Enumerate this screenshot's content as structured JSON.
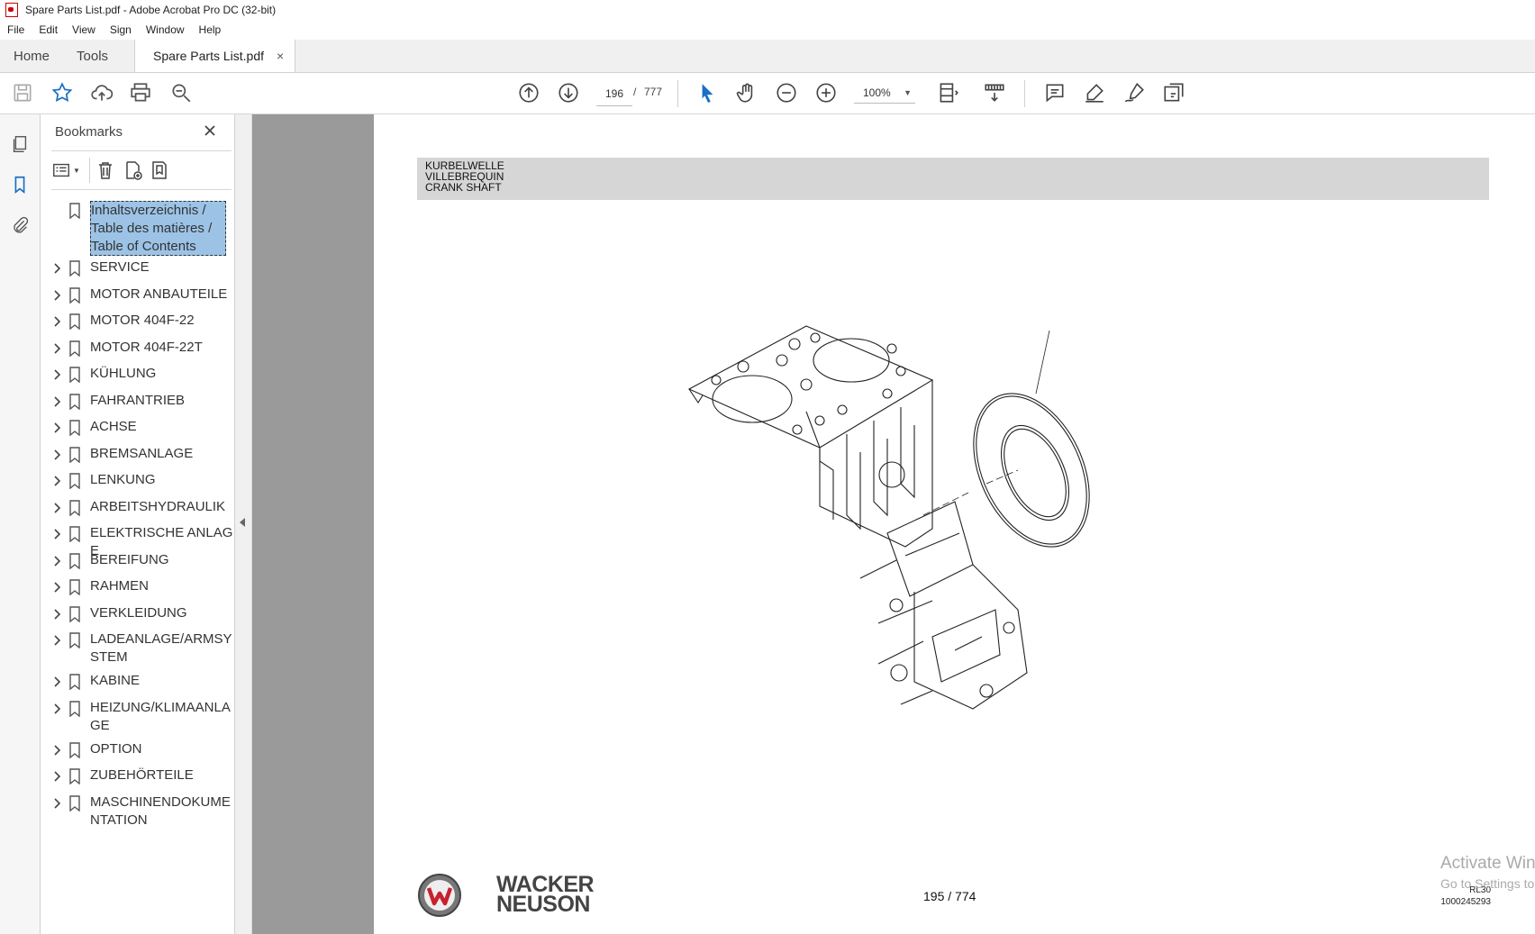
{
  "window": {
    "title": "Spare Parts List.pdf - Adobe Acrobat Pro DC (32-bit)"
  },
  "menu": [
    "File",
    "Edit",
    "View",
    "Sign",
    "Window",
    "Help"
  ],
  "tabs": {
    "home": "Home",
    "tools": "Tools",
    "document": "Spare Parts List.pdf",
    "close": "×"
  },
  "toolbar": {
    "page_current": "196",
    "page_sep": "/",
    "page_total": "777",
    "zoom": "100%"
  },
  "bookmarks": {
    "title": "Bookmarks",
    "items": [
      {
        "label": "Inhaltsverzeichnis / Table des matières / Table of Contents",
        "expandable": false,
        "selected": true
      },
      {
        "label": "SERVICE",
        "expandable": true
      },
      {
        "label": "MOTOR ANBAUTEILE",
        "expandable": true
      },
      {
        "label": "MOTOR 404F-22",
        "expandable": true
      },
      {
        "label": "MOTOR 404F-22T",
        "expandable": true
      },
      {
        "label": "KÜHLUNG",
        "expandable": true
      },
      {
        "label": "FAHRANTRIEB",
        "expandable": true
      },
      {
        "label": "ACHSE",
        "expandable": true
      },
      {
        "label": "BREMSANLAGE",
        "expandable": true
      },
      {
        "label": "LENKUNG",
        "expandable": true
      },
      {
        "label": "ARBEITSHYDRAULIK",
        "expandable": true
      },
      {
        "label": "ELEKTRISCHE ANLAGE",
        "expandable": true
      },
      {
        "label": "BEREIFUNG",
        "expandable": true
      },
      {
        "label": "RAHMEN",
        "expandable": true
      },
      {
        "label": "VERKLEIDUNG",
        "expandable": true
      },
      {
        "label": "LADEANLAGE/ARMSYSTEM",
        "expandable": true
      },
      {
        "label": "KABINE",
        "expandable": true
      },
      {
        "label": "HEIZUNG/KLIMAANLAGE",
        "expandable": true
      },
      {
        "label": "OPTION",
        "expandable": true
      },
      {
        "label": "ZUBEHÖRTEILE",
        "expandable": true
      },
      {
        "label": "MASCHINENDOKUMENTATION",
        "expandable": true
      }
    ]
  },
  "page": {
    "header_lines": [
      "KURBELWELLE",
      "VILLEBREQUIN",
      "CRANK SHAFT"
    ],
    "footer_page": "195 / 774",
    "brand_line1": "WACKER",
    "brand_line2": "NEUSON",
    "model": "RL30",
    "doc_number": "1000245293"
  },
  "watermark": {
    "line1": "Activate Windows",
    "line2": "Go to Settings to activate Windows."
  },
  "colors": {
    "selection": "#9cc3e6",
    "accent_blue": "#1a6fc6",
    "viewer_bg": "#9a9a9a",
    "header_band": "#d6d6d6"
  }
}
